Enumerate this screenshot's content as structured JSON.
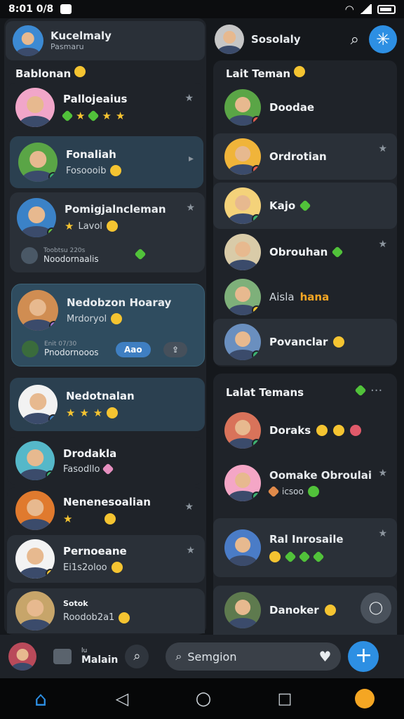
{
  "status_bar": {
    "time": "8:01 0/8"
  },
  "profile": {
    "name": "Kucelmaly",
    "sub": "Pasmaru"
  },
  "header_right": {
    "name": "Sosolaly"
  },
  "left_section": {
    "title": "Bablonan",
    "items": [
      {
        "name": "Pallojeaius",
        "sub": ""
      },
      {
        "name": "Fonaliah",
        "sub": "Fosoooib"
      },
      {
        "name": "Pomigjalncleman",
        "sub": "Lavol",
        "mini_label": "Toobtsu 220s",
        "mini_text": "Noodornaalis"
      },
      {
        "name": "Nedobzon Hoaray",
        "sub": "Mrdoryol",
        "mini_label": "Enit 07/30",
        "mini_text": "Pnodornooos",
        "pill": "Aao"
      },
      {
        "name": "Nedotnalan",
        "sub": ""
      },
      {
        "name": "Drodakla",
        "sub": "Fasodllo"
      },
      {
        "name": "Nenenesoalian",
        "sub": ""
      },
      {
        "name": "Pernoeane",
        "sub": "Ei1s2oloo"
      },
      {
        "name": "Sotok",
        "sub": "Roodob2a1"
      }
    ]
  },
  "right_section_1": {
    "title": "Lait Teman",
    "items": [
      {
        "name": "Doodae"
      },
      {
        "name": "Ordrotian"
      },
      {
        "name": "Kajo"
      },
      {
        "name": "Obrouhan"
      },
      {
        "name": "Aisla",
        "accent": "hana"
      },
      {
        "name": "Povanclar"
      }
    ]
  },
  "right_section_2": {
    "title": "Lalat Temans",
    "items": [
      {
        "name": "Doraks"
      },
      {
        "name": "Oomake Obroulai",
        "sub": "icsoo"
      },
      {
        "name": "Ral Inrosaile"
      },
      {
        "name": "Danoker"
      }
    ]
  },
  "bottom_bar": {
    "tab_label_top": "lu",
    "tab_label": "Malain",
    "search_placeholder": "Semgion"
  },
  "colors": {
    "accent": "#2d8fe3",
    "panel": "#1f2329",
    "card": "#2a3038",
    "highlight": "#2f4c5f"
  }
}
